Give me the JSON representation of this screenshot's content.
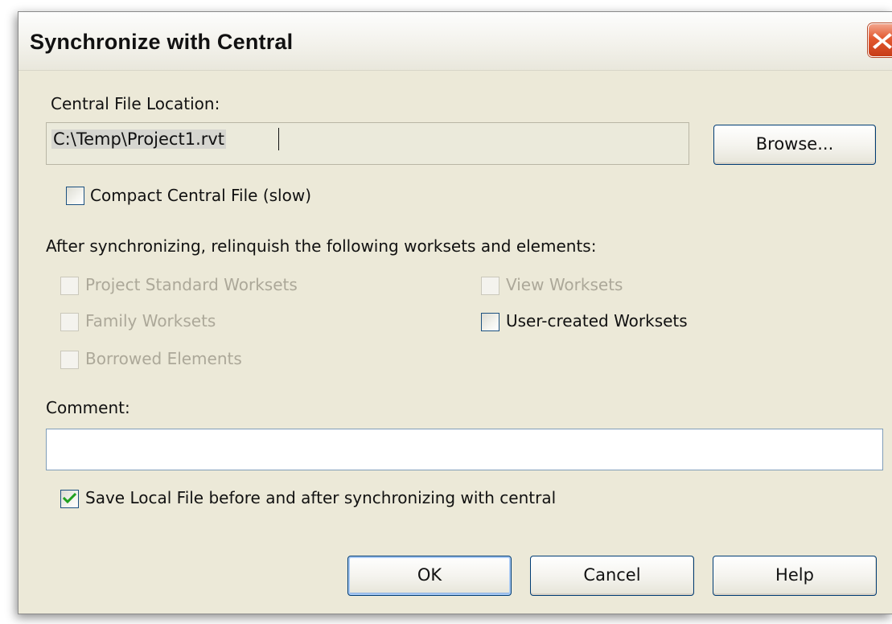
{
  "dialog": {
    "title": "Synchronize with Central",
    "close_icon": "close-x-icon"
  },
  "central_file": {
    "label": "Central File Location:",
    "path": "C:\\Temp\\Project1.rvt",
    "browse_label": "Browse..."
  },
  "compact": {
    "label": "Compact Central File (slow)",
    "checked": false
  },
  "relinquish": {
    "heading": "After synchronizing, relinquish the following worksets and elements:",
    "project_standard": {
      "label": "Project Standard Worksets",
      "checked": false,
      "enabled": false
    },
    "family": {
      "label": "Family Worksets",
      "checked": false,
      "enabled": false
    },
    "borrowed": {
      "label": "Borrowed Elements",
      "checked": false,
      "enabled": false
    },
    "view": {
      "label": "View Worksets",
      "checked": false,
      "enabled": false
    },
    "user_created": {
      "label": "User-created Worksets",
      "checked": false,
      "enabled": true
    }
  },
  "comment": {
    "label": "Comment:",
    "value": ""
  },
  "save_local": {
    "label": "Save Local File before and after synchronizing with central",
    "checked": true
  },
  "buttons": {
    "ok": "OK",
    "cancel": "Cancel",
    "help": "Help"
  },
  "colors": {
    "dialog_bg": "#ece9d8",
    "close_button": "#e2582f",
    "check_mark": "#21a121",
    "disabled_text": "#aca899"
  }
}
